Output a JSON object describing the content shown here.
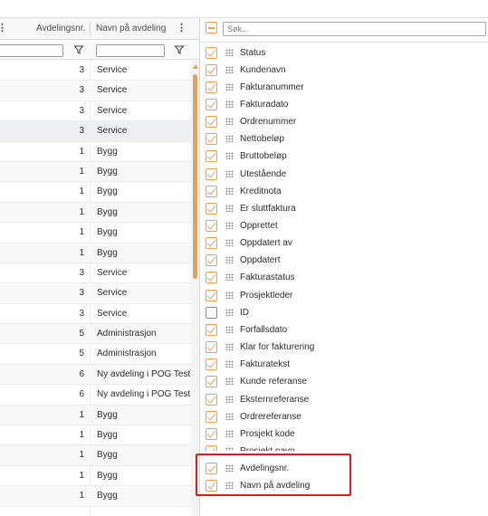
{
  "grid": {
    "headers": {
      "dept_no": "Avdelingsnr.",
      "dept_name": "Navn på avdeling"
    },
    "rows": [
      {
        "dept_no": "3",
        "dept_name": "Service"
      },
      {
        "dept_no": "3",
        "dept_name": "Service"
      },
      {
        "dept_no": "3",
        "dept_name": "Service"
      },
      {
        "dept_no": "3",
        "dept_name": "Service"
      },
      {
        "dept_no": "1",
        "dept_name": "Bygg"
      },
      {
        "dept_no": "1",
        "dept_name": "Bygg"
      },
      {
        "dept_no": "1",
        "dept_name": "Bygg"
      },
      {
        "dept_no": "1",
        "dept_name": "Bygg"
      },
      {
        "dept_no": "1",
        "dept_name": "Bygg"
      },
      {
        "dept_no": "1",
        "dept_name": "Bygg"
      },
      {
        "dept_no": "3",
        "dept_name": "Service"
      },
      {
        "dept_no": "3",
        "dept_name": "Service"
      },
      {
        "dept_no": "3",
        "dept_name": "Service"
      },
      {
        "dept_no": "5",
        "dept_name": "Administrasjon"
      },
      {
        "dept_no": "5",
        "dept_name": "Administrasjon"
      },
      {
        "dept_no": "6",
        "dept_name": "Ny avdeling i POG Test"
      },
      {
        "dept_no": "6",
        "dept_name": "Ny avdeling i POG Test"
      },
      {
        "dept_no": "1",
        "dept_name": "Bygg"
      },
      {
        "dept_no": "1",
        "dept_name": "Bygg"
      },
      {
        "dept_no": "1",
        "dept_name": "Bygg"
      },
      {
        "dept_no": "1",
        "dept_name": "Bygg"
      },
      {
        "dept_no": "1",
        "dept_name": "Bygg"
      }
    ]
  },
  "column_chooser": {
    "search_placeholder": "Søk...",
    "select_all_state": "indeterminate",
    "columns": [
      {
        "label": "Status",
        "checked": true
      },
      {
        "label": "Kundenavn",
        "checked": true
      },
      {
        "label": "Fakturanummer",
        "checked": true
      },
      {
        "label": "Fakturadato",
        "checked": true
      },
      {
        "label": "Ordrenummer",
        "checked": true
      },
      {
        "label": "Nettobeløp",
        "checked": true
      },
      {
        "label": "Bruttobeløp",
        "checked": true
      },
      {
        "label": "Utestående",
        "checked": true
      },
      {
        "label": "Kreditnota",
        "checked": true
      },
      {
        "label": "Er sluttfaktura",
        "checked": true
      },
      {
        "label": "Opprettet",
        "checked": true
      },
      {
        "label": "Oppdatert av",
        "checked": true
      },
      {
        "label": "Oppdatert",
        "checked": true
      },
      {
        "label": "Fakturastatus",
        "checked": true
      },
      {
        "label": "Prosjektleder",
        "checked": true
      },
      {
        "label": "ID",
        "checked": false
      },
      {
        "label": "Forfallsdato",
        "checked": true
      },
      {
        "label": "Klar for fakturering",
        "checked": true
      },
      {
        "label": "Fakturatekst",
        "checked": true
      },
      {
        "label": "Kunde referanse",
        "checked": true
      },
      {
        "label": "Eksternreferanse",
        "checked": true
      },
      {
        "label": "Ordrereferanse",
        "checked": true
      },
      {
        "label": "Prosjekt kode",
        "checked": true
      },
      {
        "label": "Prosjekt navn",
        "checked": true,
        "partially_hidden": true
      },
      {
        "label": "Avdelingsnr.",
        "checked": true
      },
      {
        "label": "Navn på avdeling",
        "checked": true
      }
    ]
  },
  "colors": {
    "accent": "#f0a04b",
    "highlight": "#e0191c"
  }
}
